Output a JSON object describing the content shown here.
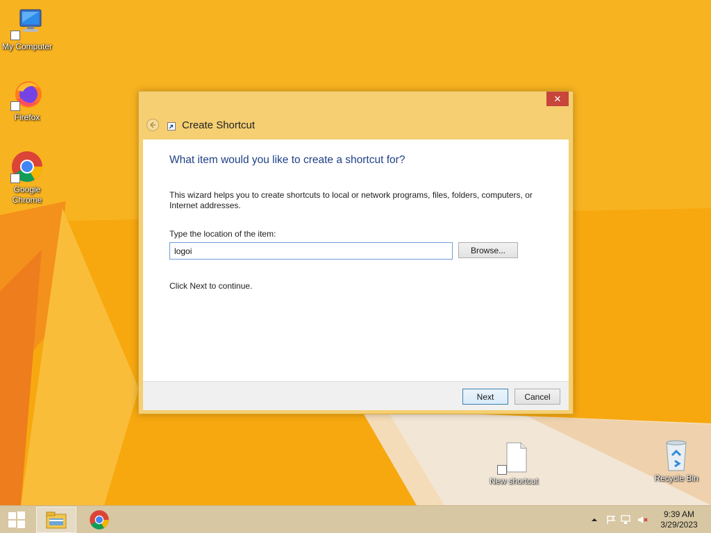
{
  "desktop": {
    "icons": [
      {
        "label": "My Computer"
      },
      {
        "label": "Firefox"
      },
      {
        "label": "Google Chrome"
      },
      {
        "label": "New shortcut"
      },
      {
        "label": "Recycle Bin"
      }
    ]
  },
  "dialog": {
    "title": "Create Shortcut",
    "close_glyph": "✕",
    "heading": "What item would you like to create a shortcut for?",
    "description": "This wizard helps you to create shortcuts to local or network programs, files, folders, computers, or Internet addresses.",
    "location_label": "Type the location of the item:",
    "location_value": "logoi",
    "browse_label": "Browse...",
    "hint": "Click Next to continue.",
    "next_label": "Next",
    "cancel_label": "Cancel"
  },
  "taskbar": {
    "apps": [
      "file-explorer",
      "google-chrome"
    ],
    "tray": {
      "icons": [
        "show-hidden-icons",
        "action-center-flag",
        "network",
        "volume-muted"
      ],
      "time": "9:39 AM",
      "date": "3/29/2023"
    }
  },
  "colors": {
    "wallpaper": "#f6a30e",
    "dialog_frame": "#f5cf72",
    "heading_text": "#1f3f85",
    "close_button": "#c7453b",
    "taskbar": "#d7c7a3"
  }
}
